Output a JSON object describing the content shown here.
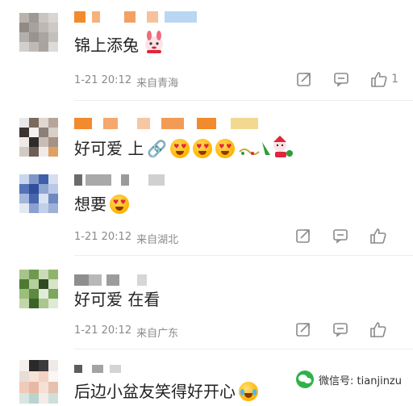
{
  "comments": [
    {
      "text": "锦上添兔",
      "time": "1-21 20:12",
      "location": "来自青海",
      "likes": "1"
    },
    {
      "text": "好可爱 上",
      "time": "",
      "location": "",
      "likes": ""
    },
    {
      "text": "想要",
      "time": "1-21 20:12",
      "location": "来自湖北",
      "likes": ""
    },
    {
      "text": "好可爱 在看",
      "time": "1-21 20:12",
      "location": "来自广东",
      "likes": ""
    },
    {
      "text": "后边小盆友笑得好开心",
      "time": "",
      "location": "",
      "likes": ""
    }
  ],
  "watermark": {
    "label": "微信号: tianjinzu"
  },
  "colors": {
    "meta_gray": "#8a8a8a",
    "divider": "#ececec",
    "wechat_green": "#2fb24a"
  },
  "icons": [
    "share-icon",
    "comment-icon",
    "like-icon",
    "wechat-icon",
    "emoji-icon"
  ]
}
